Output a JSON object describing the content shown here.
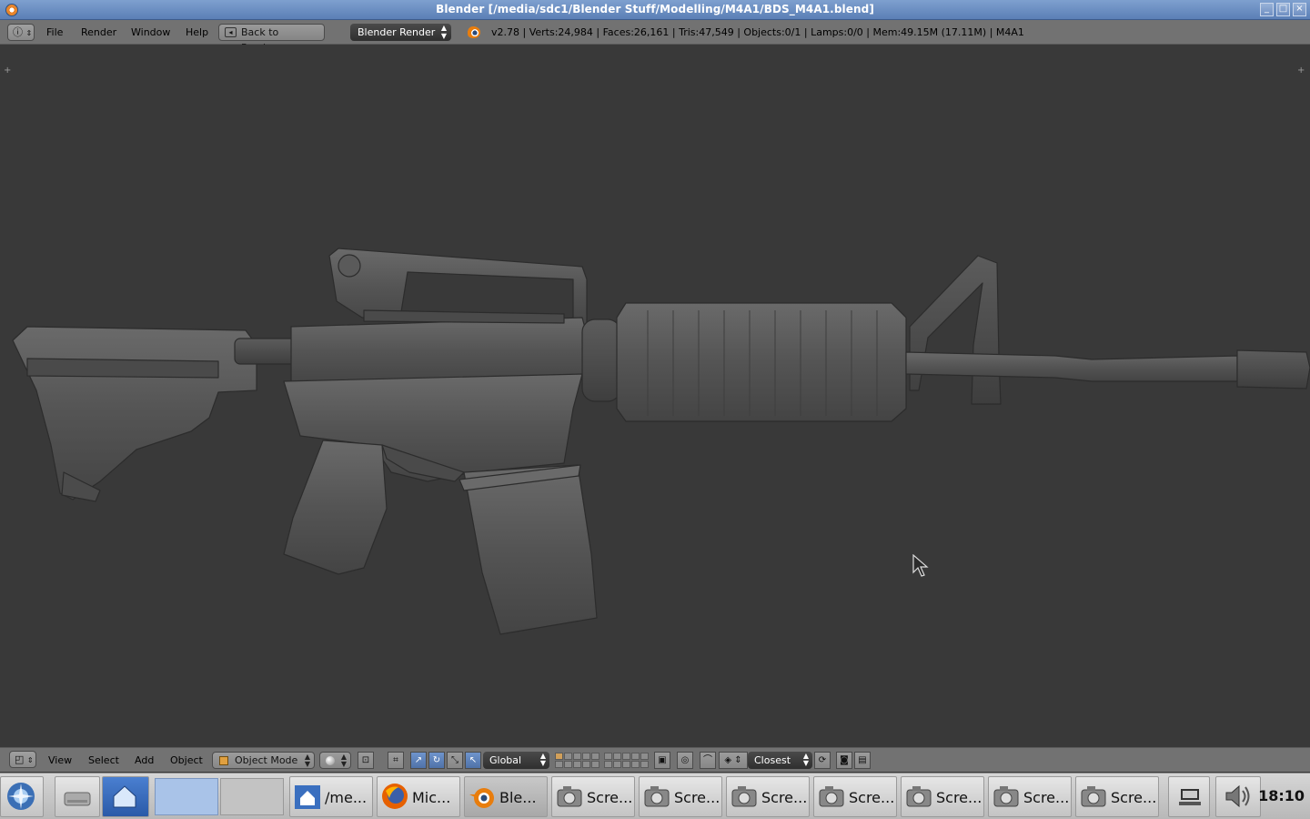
{
  "window": {
    "title": "Blender [/media/sdc1/Blender Stuff/Modelling/M4A1/BDS_M4A1.blend]",
    "buttons": [
      "_",
      "□",
      "×"
    ]
  },
  "info_header": {
    "editor_icon": "info-icon",
    "menus": [
      "File",
      "Render",
      "Window",
      "Help"
    ],
    "back_button": "Back to Previous",
    "render_engine": "Blender Render",
    "stats": "v2.78 | Verts:24,984 | Faces:26,161 | Tris:47,549 | Objects:0/1 | Lamps:0/0 | Mem:49.15M (17.11M) | M4A1"
  },
  "viewport": {
    "background": "#393939",
    "object": "M4A1 rifle model"
  },
  "view3d_header": {
    "menus": [
      "View",
      "Select",
      "Add",
      "Object"
    ],
    "mode": "Object Mode",
    "orientation": "Global",
    "snap_target": "Closest"
  },
  "taskbar": {
    "items": [
      {
        "label": "/me...",
        "icon": "home-folder-icon"
      },
      {
        "label": "Mic...",
        "icon": "firefox-icon"
      },
      {
        "label": "Ble...",
        "icon": "blender-icon"
      },
      {
        "label": "Scre...",
        "icon": "screenshot-icon"
      },
      {
        "label": "Scre...",
        "icon": "screenshot-icon"
      },
      {
        "label": "Scre...",
        "icon": "screenshot-icon"
      },
      {
        "label": "Scre...",
        "icon": "screenshot-icon"
      },
      {
        "label": "Scre...",
        "icon": "screenshot-icon"
      },
      {
        "label": "Scre...",
        "icon": "screenshot-icon"
      },
      {
        "label": "Scre...",
        "icon": "screenshot-icon"
      }
    ],
    "clock": "18:10"
  }
}
